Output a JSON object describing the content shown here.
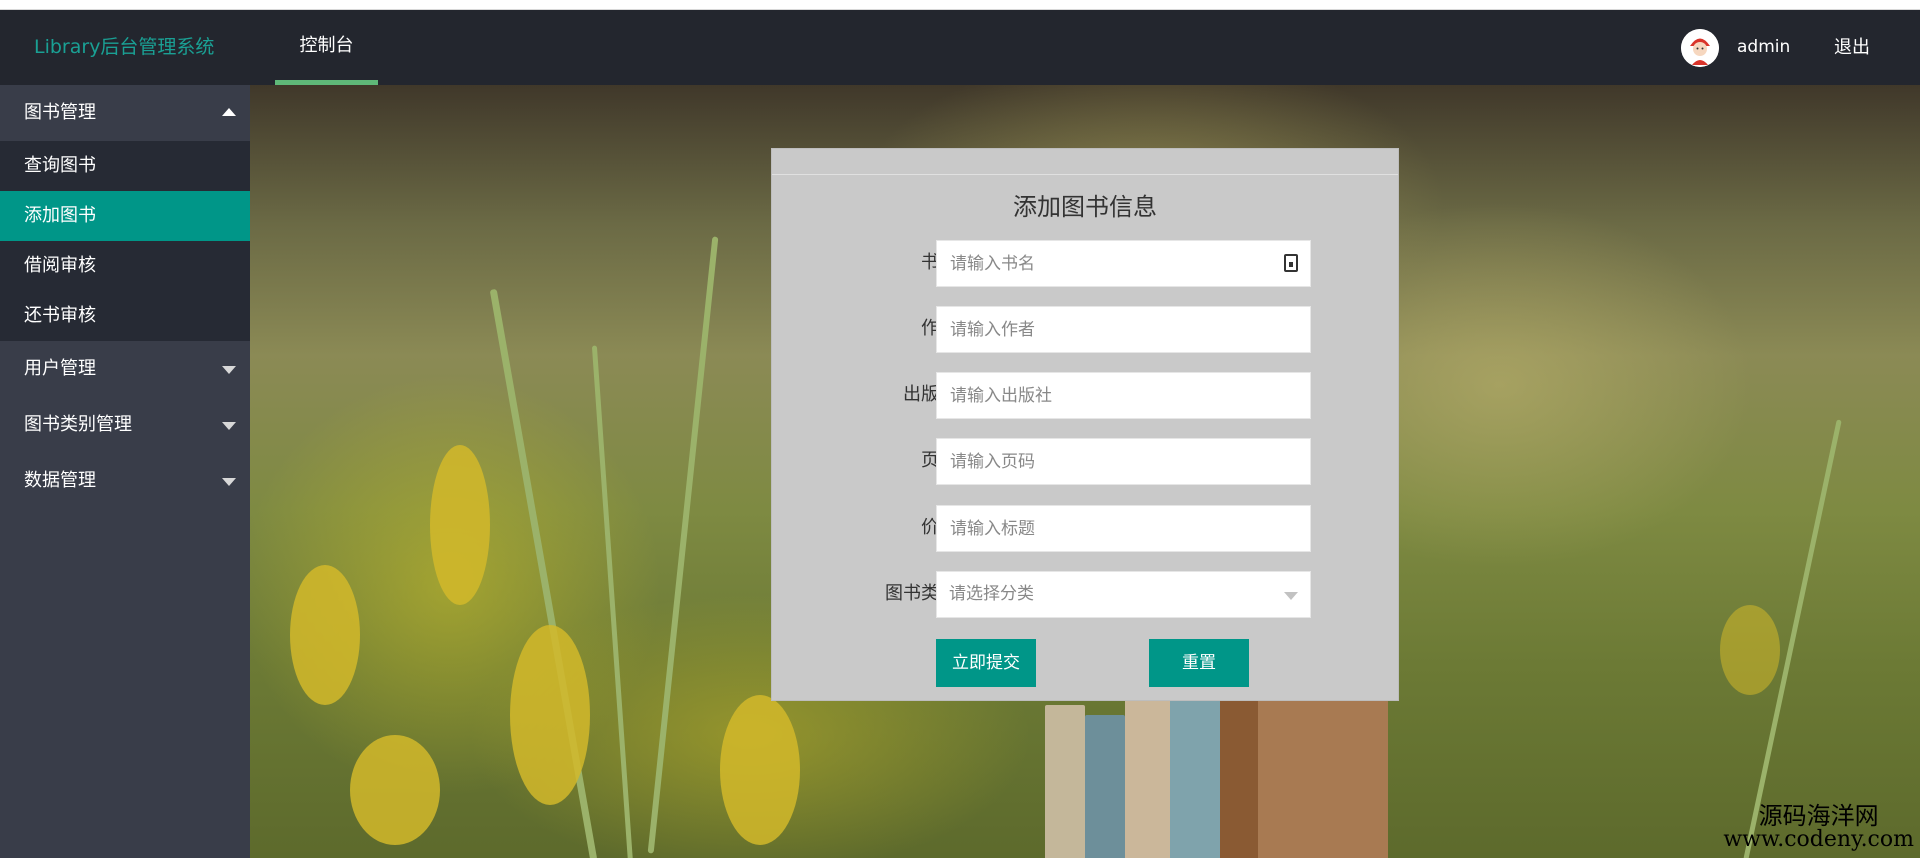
{
  "header": {
    "logo": "Library后台管理系统",
    "nav_tab": "控制台",
    "username": "admin",
    "logout": "退出"
  },
  "sidebar": {
    "groups": [
      {
        "label": "图书管理",
        "expanded": true,
        "items": [
          {
            "label": "查询图书",
            "active": false
          },
          {
            "label": "添加图书",
            "active": true
          },
          {
            "label": "借阅审核",
            "active": false
          },
          {
            "label": "还书审核",
            "active": false
          }
        ]
      },
      {
        "label": "用户管理",
        "expanded": false
      },
      {
        "label": "图书类别管理",
        "expanded": false
      },
      {
        "label": "数据管理",
        "expanded": false
      }
    ]
  },
  "form": {
    "title": "添加图书信息",
    "fields": [
      {
        "label": "书名",
        "placeholder": "请输入书名",
        "value": ""
      },
      {
        "label": "作者",
        "placeholder": "请输入作者",
        "value": ""
      },
      {
        "label": "出版社",
        "placeholder": "请输入出版社",
        "value": ""
      },
      {
        "label": "页码",
        "placeholder": "请输入页码",
        "value": ""
      },
      {
        "label": "价格",
        "placeholder": "请输入标题",
        "value": ""
      }
    ],
    "category": {
      "label": "图书类别",
      "placeholder": "请选择分类"
    },
    "submit_label": "立即提交",
    "reset_label": "重置"
  },
  "watermark": {
    "line1": "源码海洋网",
    "line2": "www.codeny.com"
  },
  "colors": {
    "header_bg": "#23262e",
    "sidebar_bg": "#393d49",
    "submenu_bg": "#262a34",
    "accent": "#009688",
    "logo": "#1aa094",
    "tab_underline": "#5fb878"
  }
}
